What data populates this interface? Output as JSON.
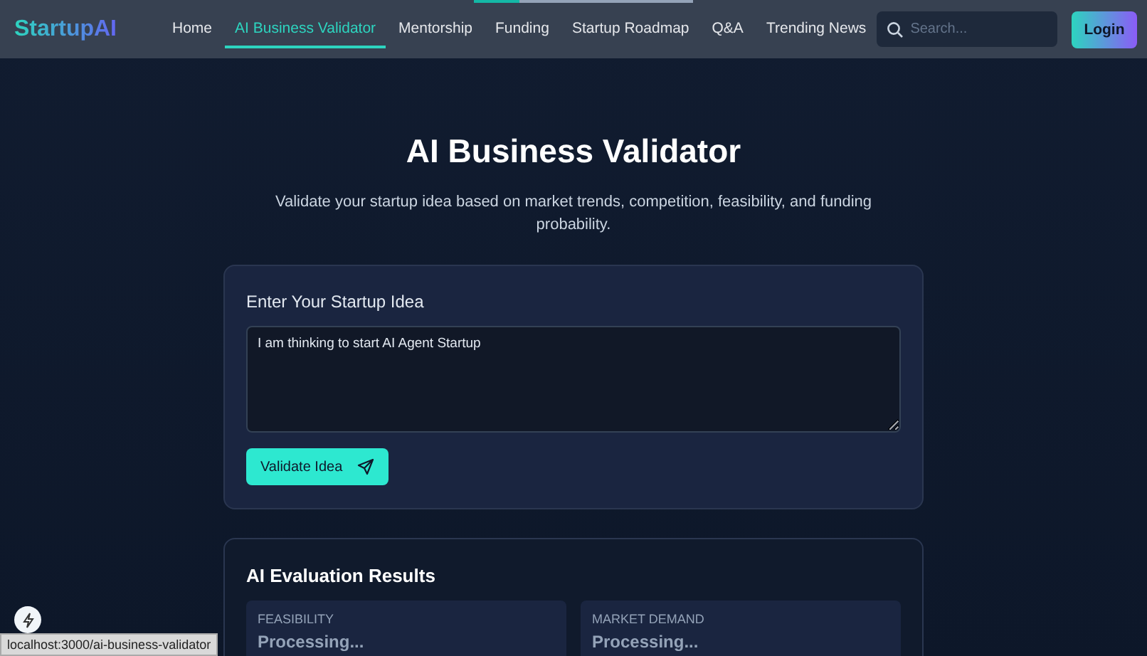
{
  "loading_bar": {
    "level": 0.21
  },
  "nav": {
    "logo": "StartupAI",
    "links": [
      {
        "label": "Home",
        "selected": false
      },
      {
        "label": "AI Business Validator",
        "selected": true
      },
      {
        "label": "Mentorship",
        "selected": false
      },
      {
        "label": "Funding",
        "selected": false
      },
      {
        "label": "Startup Roadmap",
        "selected": false
      },
      {
        "label": "Q&A",
        "selected": false
      },
      {
        "label": "Trending News",
        "selected": false
      }
    ],
    "search": {
      "placeholder": "Search..."
    },
    "login": "Login"
  },
  "hero": {
    "title": "AI Business Validator",
    "subtitle": "Validate your startup idea based on market trends, competition, feasibility, and funding probability."
  },
  "idea_form": {
    "heading": "Enter Your Startup Idea",
    "value": "I am thinking to start AI Agent Startup",
    "button": "Validate Idea"
  },
  "results": {
    "heading": "AI Evaluation Results",
    "cards": [
      {
        "label": "FEASIBILITY",
        "value": "Processing..."
      },
      {
        "label": "MARKET DEMAND",
        "value": "Processing..."
      }
    ]
  },
  "status_url": "localhost:3000/ai-business-validator"
}
